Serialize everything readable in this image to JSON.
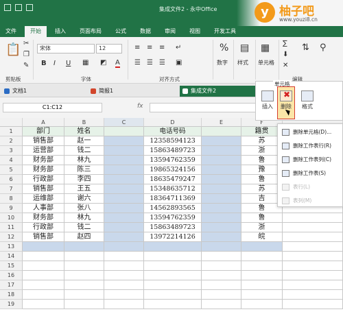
{
  "window": {
    "title": "集成文件2 - 永中Office",
    "quick_access": [
      "save",
      "undo",
      "redo"
    ]
  },
  "brand": {
    "circle_letter": "y",
    "name": "柚子吧",
    "url": "www.youzi8.cn",
    "color": "#f39a1a"
  },
  "tabs": [
    "文件",
    "开始",
    "插入",
    "页面布局",
    "公式",
    "数据",
    "审阅",
    "视图",
    "开发工具"
  ],
  "active_tab": "开始",
  "ribbon": {
    "font_name": "宋体",
    "font_size": "12",
    "groups": {
      "clipboard": "剪贴板",
      "font": "字体",
      "align": "对齐方式",
      "number": "数字",
      "style": "样式",
      "cells": "单元格",
      "edit": "编辑"
    },
    "number_symbol": "%",
    "bold": "B",
    "italic": "I",
    "underline": "U",
    "font_color": "A"
  },
  "doc_tabs": [
    "文档1",
    "简报1",
    "集成文件2"
  ],
  "active_doc_tab": "集成文件2",
  "formula_bar": {
    "name_box": "C1:C12",
    "fx": "fx",
    "value": ""
  },
  "cells_popup": {
    "title": "单元格",
    "insert": "插入",
    "delete": "删除",
    "format": "格式"
  },
  "delete_menu": [
    {
      "label": "删除单元格(D)...",
      "enabled": true
    },
    {
      "label": "删除工作表行(R)",
      "enabled": true
    },
    {
      "label": "删除工作表列(C)",
      "enabled": true
    },
    {
      "label": "删除工作表(S)",
      "enabled": true
    },
    {
      "label": "表行(L)",
      "enabled": false
    },
    {
      "label": "表列(M)",
      "enabled": false
    }
  ],
  "sheet": {
    "columns": [
      "A",
      "B",
      "C",
      "D",
      "E",
      "F"
    ],
    "header_row": [
      "部门",
      "姓名",
      "",
      "电话号码",
      "",
      "籍贯"
    ],
    "rows": [
      [
        "销售部",
        "赵一",
        "",
        "12358594123",
        "",
        "苏"
      ],
      [
        "运营部",
        "钱二",
        "",
        "15863489723",
        "",
        "浙"
      ],
      [
        "财务部",
        "林九",
        "",
        "13594762359",
        "",
        "鲁"
      ],
      [
        "财务部",
        "陈三",
        "",
        "19865324156",
        "",
        "豫"
      ],
      [
        "行政部",
        "李四",
        "",
        "18635479247",
        "",
        "鲁"
      ],
      [
        "销售部",
        "王五",
        "",
        "15348635712",
        "",
        "苏"
      ],
      [
        "运维部",
        "谢六",
        "",
        "18364711369",
        "",
        "吉"
      ],
      [
        "人事部",
        "张八",
        "",
        "14562893565",
        "",
        "鲁"
      ],
      [
        "财务部",
        "林九",
        "",
        "13594762359",
        "",
        "鲁"
      ],
      [
        "行政部",
        "钱二",
        "",
        "15863489723",
        "",
        "浙"
      ],
      [
        "销售部",
        "赵四",
        "",
        "13972214126",
        "",
        "皖"
      ]
    ],
    "row_numbers": [
      "1",
      "2",
      "3",
      "4",
      "5",
      "6",
      "7",
      "8",
      "9",
      "10",
      "11",
      "12",
      "13",
      "14",
      "15",
      "16",
      "17",
      "18",
      "19"
    ]
  }
}
